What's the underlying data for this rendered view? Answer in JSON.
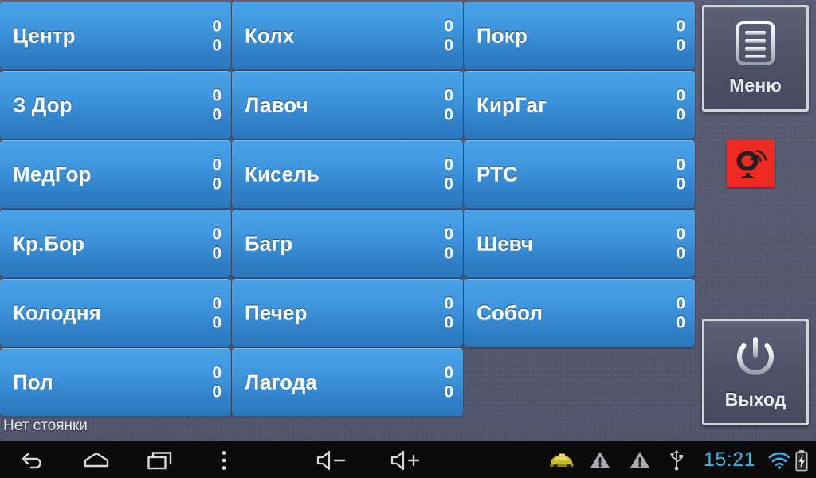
{
  "app": {
    "status_text": "Нет стоянки",
    "accent_blue": "#3f96de",
    "panel_bg": "#565a72",
    "alert_red": "#ee2a22"
  },
  "grid": {
    "stations": [
      {
        "name": "Центр",
        "count_top": "0",
        "count_bottom": "0"
      },
      {
        "name": "Колх",
        "count_top": "0",
        "count_bottom": "0"
      },
      {
        "name": "Покр",
        "count_top": "0",
        "count_bottom": "0"
      },
      {
        "name": "З Дор",
        "count_top": "0",
        "count_bottom": "0"
      },
      {
        "name": "Лавоч",
        "count_top": "0",
        "count_bottom": "0"
      },
      {
        "name": "КирГаг",
        "count_top": "0",
        "count_bottom": "0"
      },
      {
        "name": "МедГор",
        "count_top": "0",
        "count_bottom": "0"
      },
      {
        "name": "Кисель",
        "count_top": "0",
        "count_bottom": "0"
      },
      {
        "name": "РТС",
        "count_top": "0",
        "count_bottom": "0"
      },
      {
        "name": "Кр.Бор",
        "count_top": "0",
        "count_bottom": "0"
      },
      {
        "name": "Багр",
        "count_top": "0",
        "count_bottom": "0"
      },
      {
        "name": "Шевч",
        "count_top": "0",
        "count_bottom": "0"
      },
      {
        "name": "Колодня",
        "count_top": "0",
        "count_bottom": "0"
      },
      {
        "name": "Печер",
        "count_top": "0",
        "count_bottom": "0"
      },
      {
        "name": "Собол",
        "count_top": "0",
        "count_bottom": "0"
      },
      {
        "name": "Пол",
        "count_top": "0",
        "count_bottom": "0"
      },
      {
        "name": "Лагода",
        "count_top": "0",
        "count_bottom": "0"
      }
    ]
  },
  "side_panel": {
    "menu_label": "Меню",
    "menu_icon": "list-document-icon",
    "exit_label": "Выход",
    "exit_icon": "power-icon",
    "gps_icon": "satellite-dish-icon"
  },
  "navbar": {
    "buttons": [
      {
        "icon": "back-icon"
      },
      {
        "icon": "home-icon"
      },
      {
        "icon": "recents-icon"
      },
      {
        "icon": "overflow-menu-icon"
      },
      {
        "icon": "volume-down-icon"
      },
      {
        "icon": "volume-up-icon"
      }
    ],
    "status_icons": [
      {
        "icon": "taxi-car-icon"
      },
      {
        "icon": "warning-triangle-icon"
      },
      {
        "icon": "warning-triangle-icon"
      },
      {
        "icon": "usb-icon"
      }
    ],
    "clock": "15:21",
    "wifi_icon": "wifi-icon",
    "battery_icon": "battery-charging-icon",
    "clock_color": "#32b8e8"
  }
}
